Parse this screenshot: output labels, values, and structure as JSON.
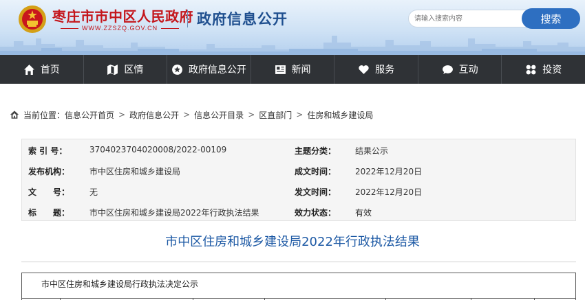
{
  "header": {
    "site_name": "枣庄市市中区人民政府",
    "site_url": "WWW.ZZSZQ.GOV.CN",
    "section_title": "政府信息公开",
    "search_placeholder": "请输入搜索内容",
    "search_button": "搜索"
  },
  "nav": {
    "items": [
      {
        "label": "首页",
        "icon": "home-icon"
      },
      {
        "label": "区情",
        "icon": "map-icon"
      },
      {
        "label": "政府信息公开",
        "icon": "info-circle-icon"
      },
      {
        "label": "新闻",
        "icon": "news-icon"
      },
      {
        "label": "服务",
        "icon": "heart-icon"
      },
      {
        "label": "互动",
        "icon": "chat-icon"
      },
      {
        "label": "投资",
        "icon": "grid-icon"
      }
    ]
  },
  "breadcrumb": {
    "prefix": "当前位置：",
    "items": [
      "信息公开首页",
      "政府信息公开",
      "信息公开目录",
      "区直部门",
      "住房和城乡建设局"
    ]
  },
  "meta": {
    "index_label": "索 引 号：",
    "index_value": "3704023704020008/2022-00109",
    "category_label": "主题分类：",
    "category_value": "结果公示",
    "org_label": "发布机构：",
    "org_value": "市中区住房和城乡建设局",
    "created_label": "成文时间：",
    "created_value": "2022年12月20日",
    "docno_label": "文　　号：",
    "docno_value": "无",
    "published_label": "发文时间：",
    "published_value": "2022年12月20日",
    "title_label": "标　　题：",
    "title_value": "市中区住房和城乡建设局2022年行政执法结果",
    "status_label": "效力状态：",
    "status_value": "有效"
  },
  "article": {
    "title": "市中区住房和城乡建设局2022年行政执法结果",
    "table_heading": "市中区住房和城乡建设局行政执法决定公示"
  },
  "colors": {
    "brand_red": "#c4161c",
    "brand_blue": "#1f4f8f",
    "nav_bg": "#2f3236",
    "title_blue": "#1e5aa5",
    "search_button": "#2e6fc1"
  }
}
